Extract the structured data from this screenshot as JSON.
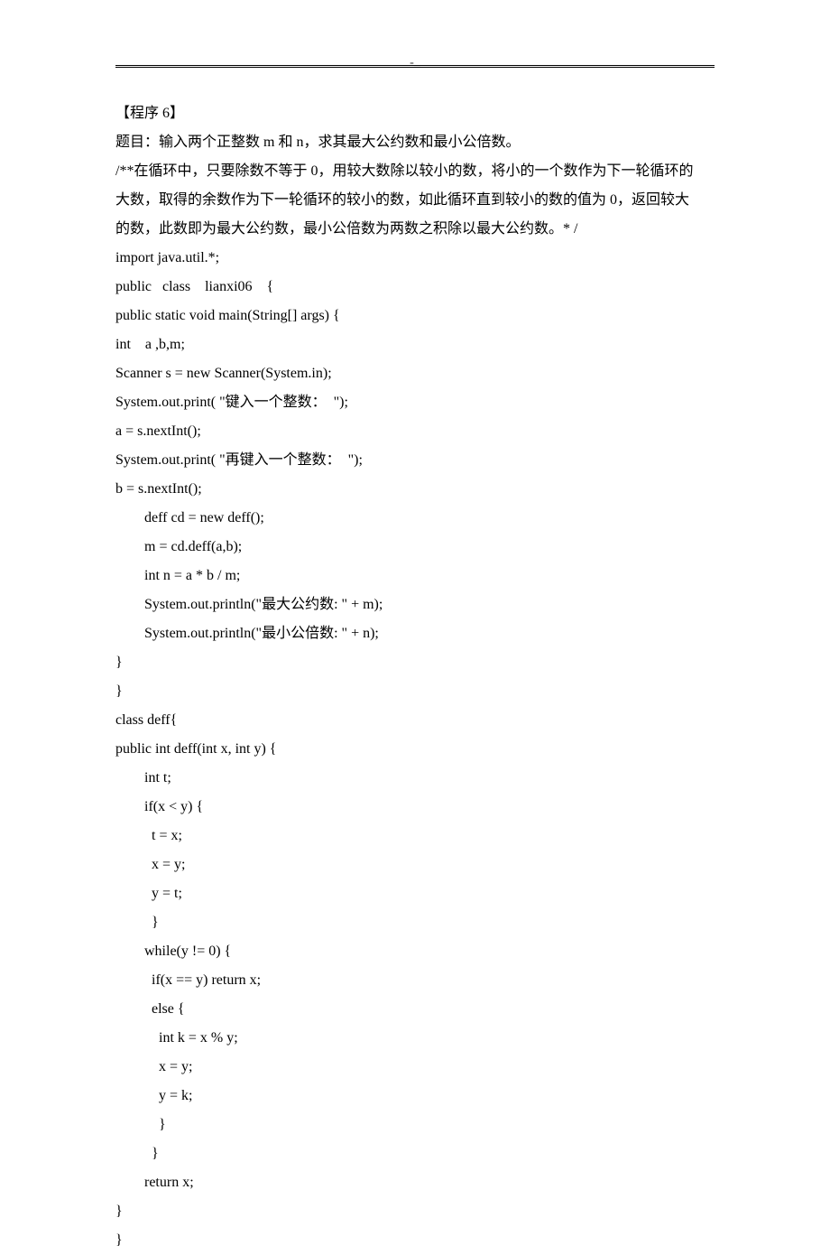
{
  "header_mark": "-_",
  "lines": [
    {
      "cls": "",
      "t": "【程序 6】"
    },
    {
      "cls": "",
      "t": "题目：输入两个正整数 m 和 n，求其最大公约数和最小公倍数。"
    },
    {
      "cls": "",
      "t": "/**在循环中，只要除数不等于 0，用较大数除以较小的数，将小的一个数作为下一轮循环的"
    },
    {
      "cls": "",
      "t": "大数，取得的余数作为下一轮循环的较小的数，如此循环直到较小的数的值为 0，返回较大"
    },
    {
      "cls": "",
      "t": "的数，此数即为最大公约数，最小公倍数为两数之积除以最大公约数。* /"
    },
    {
      "cls": "",
      "t": "import java.util.*;"
    },
    {
      "cls": "",
      "t": "public   class    lianxi06    {"
    },
    {
      "cls": "",
      "t": "public static void main(String[] args) {"
    },
    {
      "cls": "",
      "t": "int    a ,b,m;"
    },
    {
      "cls": "",
      "t": "Scanner s = new Scanner(System.in);"
    },
    {
      "cls": "",
      "t": "System.out.print( \"键入一个整数：  \");"
    },
    {
      "cls": "",
      "t": "a = s.nextInt();"
    },
    {
      "cls": "",
      "t": "System.out.print( \"再键入一个整数：  \");"
    },
    {
      "cls": "",
      "t": "b = s.nextInt();"
    },
    {
      "cls": "indent1",
      "t": "deff cd = new deff();"
    },
    {
      "cls": "indent1",
      "t": "m = cd.deff(a,b);"
    },
    {
      "cls": "indent1",
      "t": "int n = a * b / m;"
    },
    {
      "cls": "indent1",
      "t": "System.out.println(\"最大公约数: \" + m);"
    },
    {
      "cls": "indent1",
      "t": "System.out.println(\"最小公倍数: \" + n);"
    },
    {
      "cls": "",
      "t": "}"
    },
    {
      "cls": "",
      "t": "}"
    },
    {
      "cls": "",
      "t": "class deff{"
    },
    {
      "cls": "",
      "t": "public int deff(int x, int y) {"
    },
    {
      "cls": "indent1",
      "t": "int t;"
    },
    {
      "cls": "indent1",
      "t": "if(x < y) {"
    },
    {
      "cls": "indent2",
      "t": "t = x;"
    },
    {
      "cls": "indent2",
      "t": "x = y;"
    },
    {
      "cls": "indent2",
      "t": "y = t;"
    },
    {
      "cls": "indent2",
      "t": "}"
    },
    {
      "cls": "indent1",
      "t": "while(y != 0) {"
    },
    {
      "cls": "indent2",
      "t": "if(x == y) return x;"
    },
    {
      "cls": "indent2",
      "t": "else {"
    },
    {
      "cls": "indent3",
      "t": "int k = x % y;"
    },
    {
      "cls": "indent3",
      "t": "x = y;"
    },
    {
      "cls": "indent3",
      "t": "y = k;"
    },
    {
      "cls": "indent3",
      "t": "}"
    },
    {
      "cls": "indent2",
      "t": "}"
    },
    {
      "cls": "indent1",
      "t": "return x;"
    },
    {
      "cls": "",
      "t": "}"
    },
    {
      "cls": "",
      "t": "}"
    }
  ]
}
